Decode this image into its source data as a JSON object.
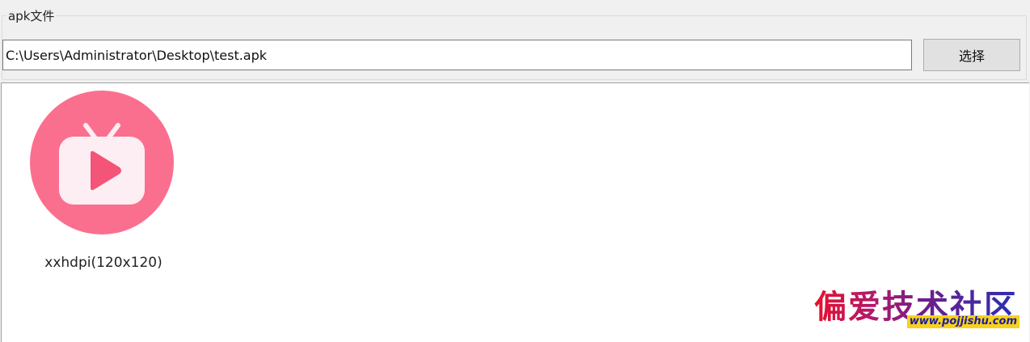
{
  "groupbox": {
    "title": "apk文件"
  },
  "path_field": {
    "value": "C:\\Users\\Administrator\\Desktop\\test.apk"
  },
  "select_button": {
    "label": "选择"
  },
  "icons": [
    {
      "caption": "xxhdpi(120x120)",
      "icon_name": "tv-play-icon",
      "colors": {
        "circle": "#fb6f8e",
        "screen": "#fdeef3",
        "play": "#f35478"
      }
    }
  ],
  "watermark": {
    "title": "偏爱技术社区",
    "url": "www.pojjishu.com"
  }
}
